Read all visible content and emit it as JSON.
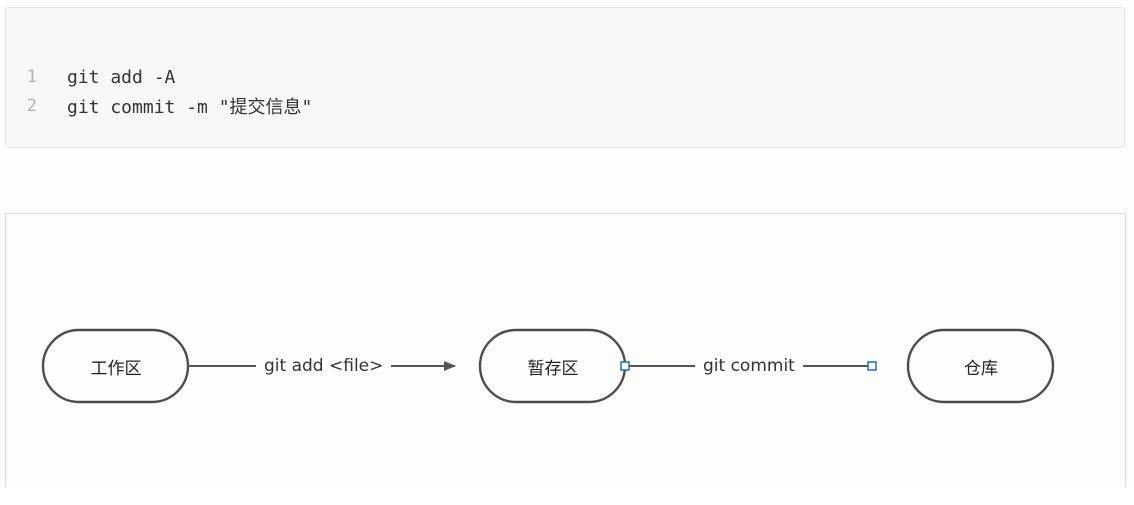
{
  "code_block": {
    "lines": [
      {
        "number": "1",
        "text": "git add -A"
      },
      {
        "number": "2",
        "text": "git commit -m \"提交信息\""
      }
    ]
  },
  "diagram": {
    "nodes": [
      {
        "id": "workspace",
        "label": "工作区"
      },
      {
        "id": "staging",
        "label": "暂存区"
      },
      {
        "id": "repository",
        "label": "仓库"
      }
    ],
    "edges": [
      {
        "from": "workspace",
        "to": "staging",
        "label": "git add <file>"
      },
      {
        "from": "staging",
        "to": "repository",
        "label": "git commit"
      }
    ],
    "colors": {
      "node_stroke": "#4d4d4d",
      "edge_stroke": "#555555",
      "connector_handle": "#1f6fb2"
    }
  }
}
